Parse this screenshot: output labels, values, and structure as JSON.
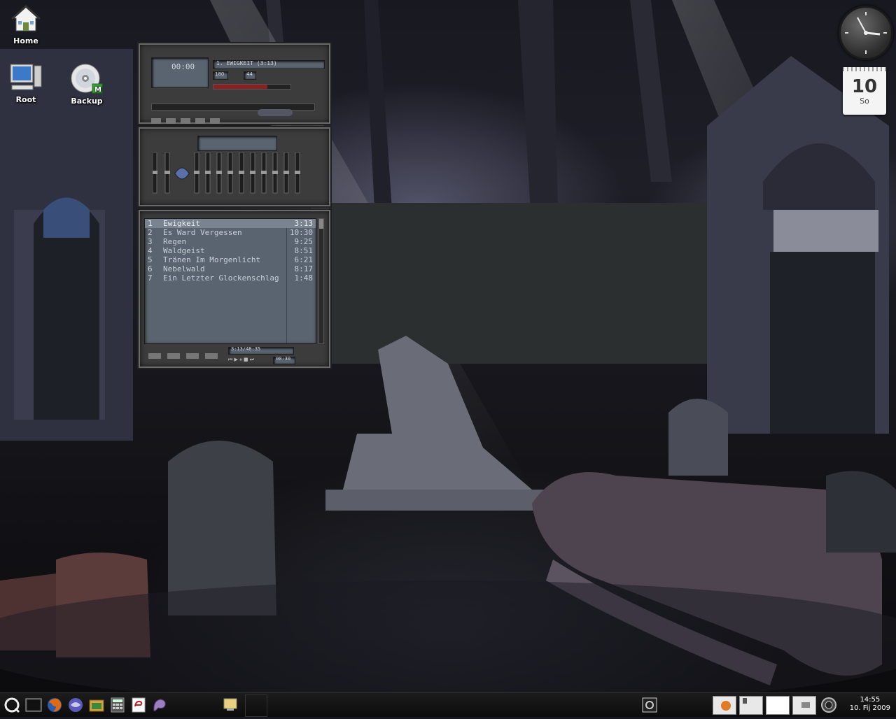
{
  "desktop": {
    "icons": [
      {
        "label": "Home"
      },
      {
        "label": "Root"
      },
      {
        "label": "Backup"
      }
    ]
  },
  "player": {
    "now_playing": "1. EWIGKEIT (3:13)",
    "time_display": "00:00",
    "bitrate": "180",
    "samplerate": "44",
    "playlist_time": "3:13/48:35",
    "playlist_clock": "00:30",
    "tracks": [
      {
        "num": "1",
        "title": "Ewigkeit",
        "duration": "3:13"
      },
      {
        "num": "2",
        "title": "Es Ward Vergessen",
        "duration": "10:30"
      },
      {
        "num": "3",
        "title": "Regen",
        "duration": "9:25"
      },
      {
        "num": "4",
        "title": "Waldgeist",
        "duration": "8:51"
      },
      {
        "num": "5",
        "title": "Tränen Im Morgenlicht",
        "duration": "6:21"
      },
      {
        "num": "6",
        "title": "Nebelwald",
        "duration": "8:17"
      },
      {
        "num": "7",
        "title": "Ein Letzter Glockenschlag",
        "duration": "1:48"
      }
    ],
    "selected_index": 0
  },
  "calendar_widget": {
    "day": "10",
    "weekday": "So"
  },
  "taskbar": {
    "time": "14:55",
    "date": "10. Fij 2009"
  }
}
